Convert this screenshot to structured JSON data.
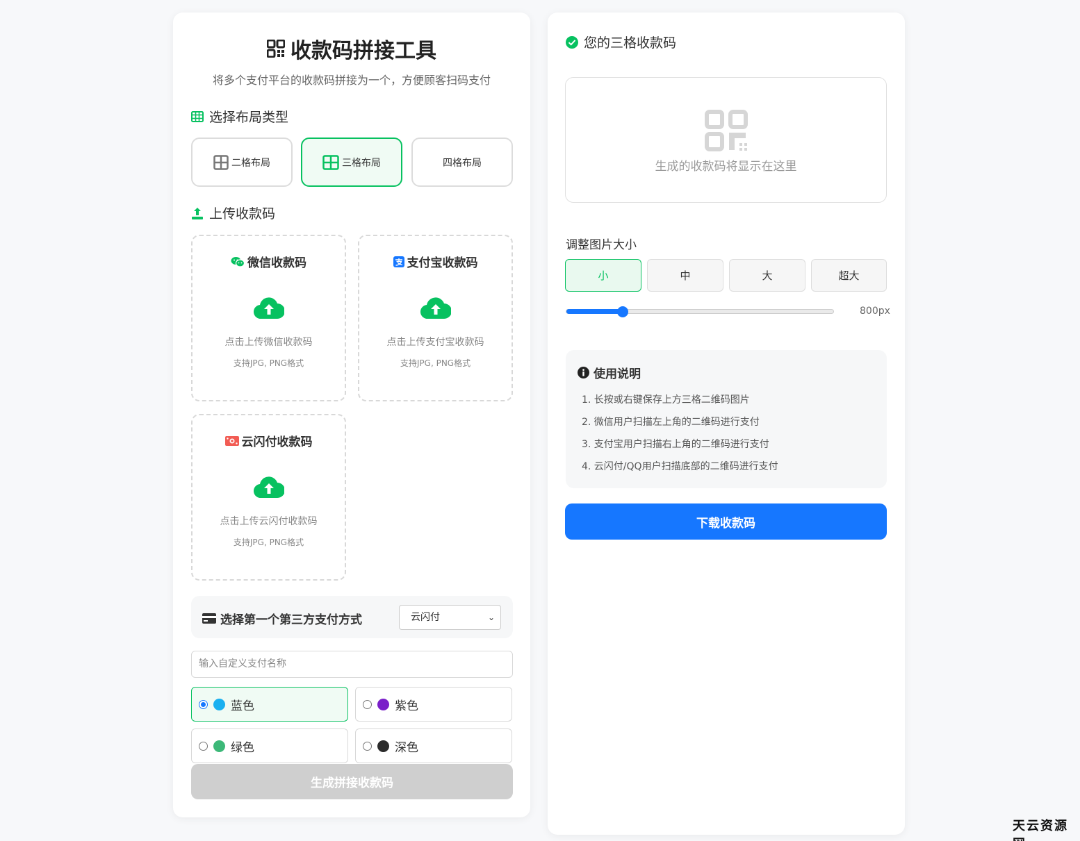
{
  "app": {
    "title": "收款码拼接工具",
    "subtitle": "将多个支付平台的收款码拼接为一个，方便顾客扫码支付"
  },
  "layout_section": {
    "heading": "选择布局类型",
    "options": [
      {
        "label": "二格布局",
        "selected": false
      },
      {
        "label": "三格布局",
        "selected": true
      },
      {
        "label": "四格布局",
        "selected": false
      }
    ]
  },
  "upload_section": {
    "heading": "上传收款码",
    "boxes": [
      {
        "title": "微信收款码",
        "hint": "点击上传微信收款码",
        "format": "支持JPG, PNG格式"
      },
      {
        "title": "支付宝收款码",
        "hint": "点击上传支付宝收款码",
        "format": "支持JPG, PNG格式"
      },
      {
        "title": "云闪付收款码",
        "hint": "点击上传云闪付收款码",
        "format": "支持JPG, PNG格式"
      }
    ]
  },
  "third_party": {
    "label": "选择第一个第三方支付方式",
    "selected": "云闪付"
  },
  "custom_name": {
    "placeholder": "输入自定义支付名称"
  },
  "colors": [
    {
      "label": "蓝色",
      "swatch": "#1ab0f0",
      "checked": true
    },
    {
      "label": "紫色",
      "swatch": "#7a1fc9",
      "checked": false
    },
    {
      "label": "绿色",
      "swatch": "#3cb878",
      "checked": false
    },
    {
      "label": "深色",
      "swatch": "#2b2b2b",
      "checked": false
    }
  ],
  "generate_button": "生成拼接收款码",
  "result": {
    "heading": "您的三格收款码",
    "placeholder": "生成的收款码将显示在这里"
  },
  "size": {
    "label": "调整图片大小",
    "options": [
      {
        "label": "小",
        "selected": true
      },
      {
        "label": "中",
        "selected": false
      },
      {
        "label": "大",
        "selected": false
      },
      {
        "label": "超大",
        "selected": false
      }
    ],
    "slider_fraction": 0.21,
    "value_text": "800px"
  },
  "guide": {
    "title": "使用说明",
    "steps": [
      "1. 长按或右键保存上方三格二维码图片",
      "2. 微信用户扫描左上角的二维码进行支付",
      "3. 支付宝用户扫描右上角的二维码进行支付",
      "4. 云闪付/QQ用户扫描底部的二维码进行支付"
    ]
  },
  "download_button": "下载收款码",
  "watermark": "天云资源网",
  "theme": {
    "primary_green": "#07c160",
    "primary_blue": "#1677ff",
    "disabled_gray": "#cfcfcf"
  }
}
